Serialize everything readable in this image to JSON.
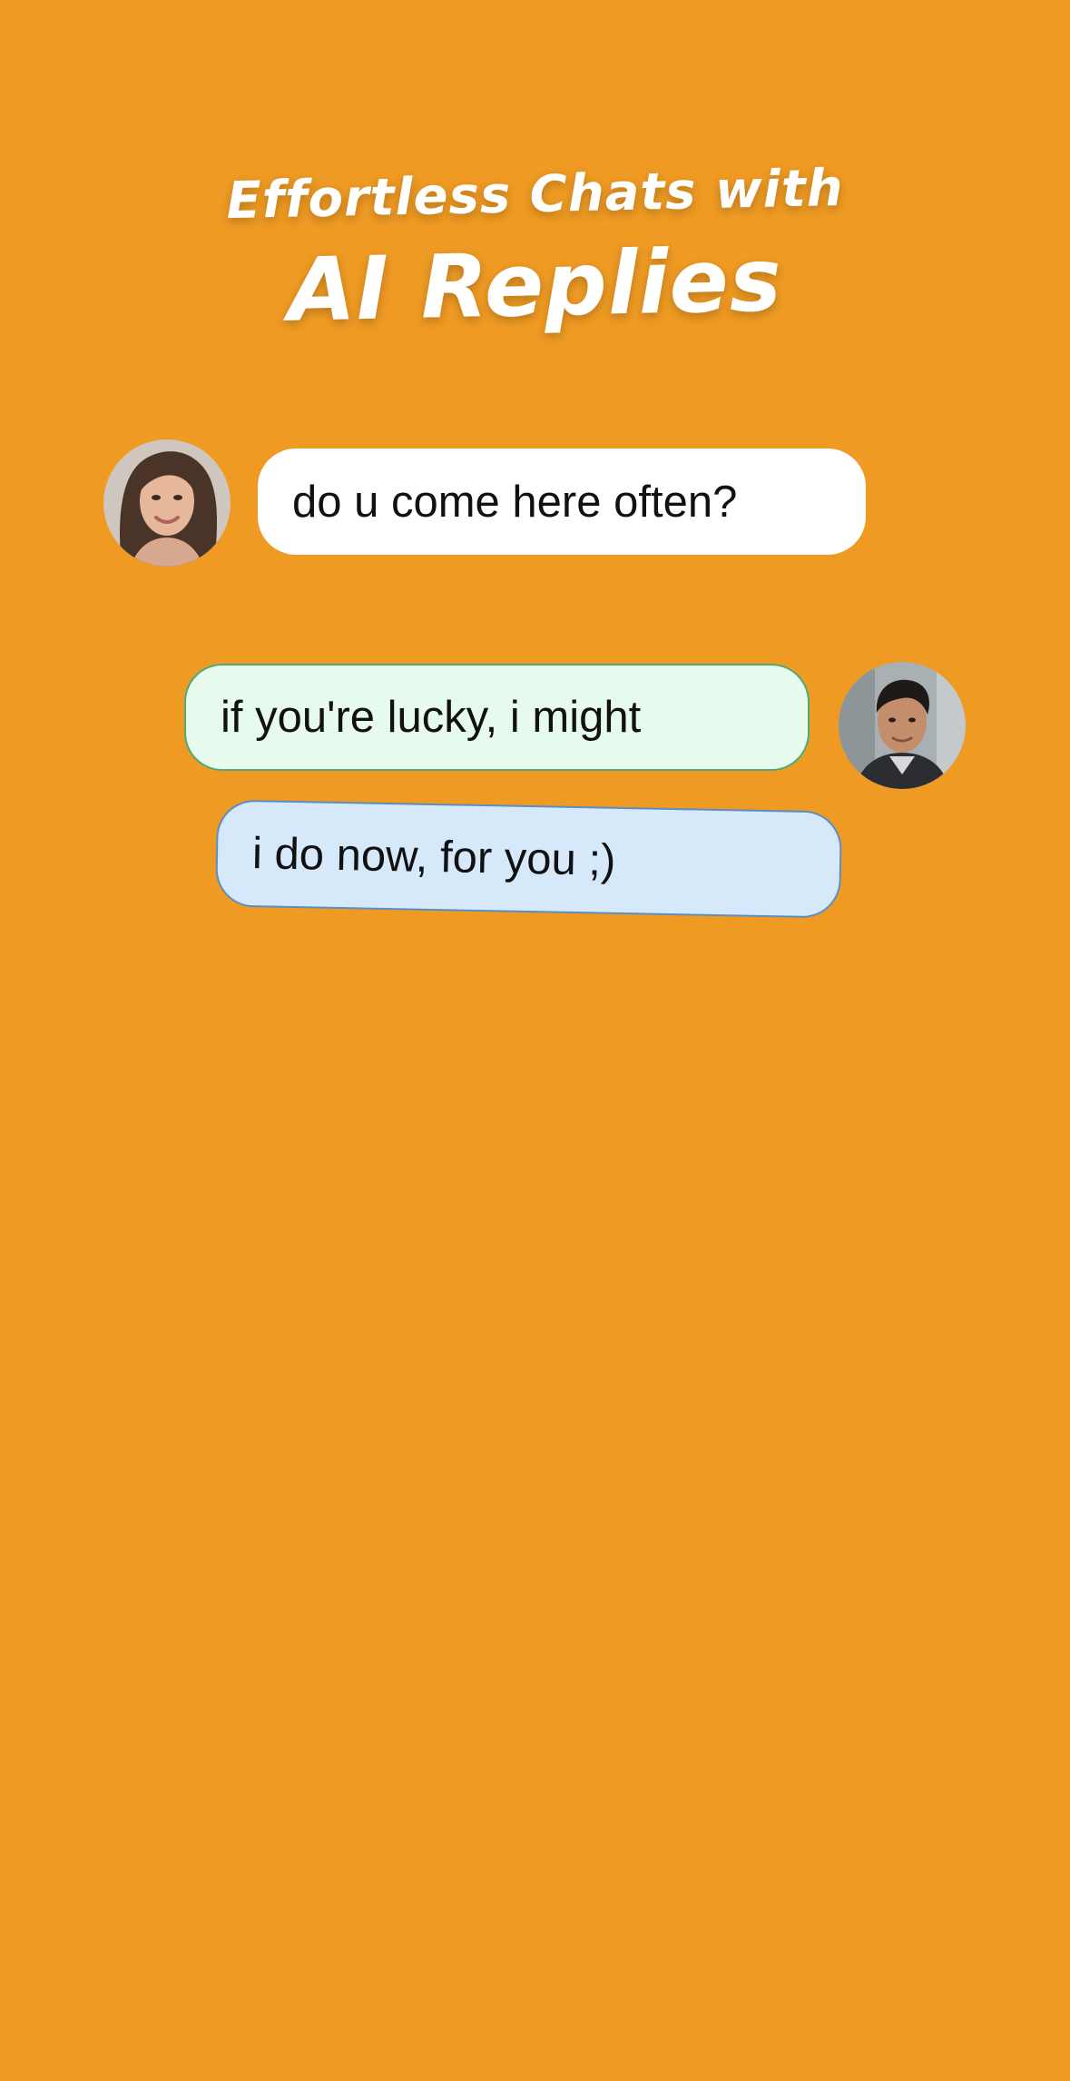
{
  "headline": {
    "line1": "Effortless Chats with",
    "line2": "AI Replies"
  },
  "chat": {
    "incoming": {
      "avatar_icon": "woman-avatar-icon",
      "text": "do u come here often?"
    },
    "suggestions": [
      {
        "text": "if you're lucky, i might",
        "color": "#e6fbee"
      },
      {
        "text": "i do now, for you ;)",
        "color": "#d6e9fb"
      }
    ],
    "outgoing_avatar_icon": "man-avatar-icon"
  },
  "colors": {
    "background": "#ee9a23",
    "headline": "#ffffff",
    "incoming_bubble": "#ffffff"
  }
}
